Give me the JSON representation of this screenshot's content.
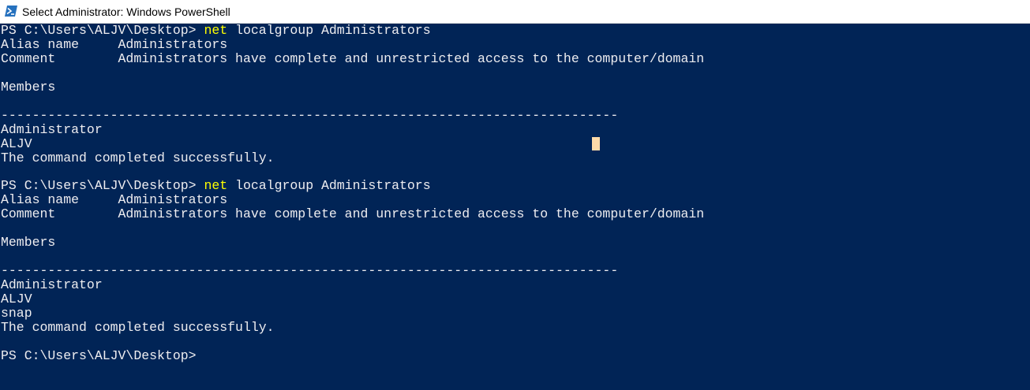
{
  "window": {
    "title": "Select Administrator: Windows PowerShell",
    "icon": "powershell-icon"
  },
  "colors": {
    "background": "#012456",
    "foreground": "#eeedf0",
    "command": "#ffff00",
    "cursor": "#fedba9"
  },
  "console": {
    "blocks": [
      {
        "prompt": "PS C:\\Users\\ALJV\\Desktop> ",
        "command": "net",
        "args": " localgroup Administrators",
        "alias_label": "Alias name     ",
        "alias_value": "Administrators",
        "comment_label": "Comment        ",
        "comment_value": "Administrators have complete and unrestricted access to the computer/domain",
        "members_header": "Members",
        "separator": "-------------------------------------------------------------------------------",
        "members": [
          "Administrator",
          "ALJV"
        ],
        "result": "The command completed successfully."
      },
      {
        "prompt": "PS C:\\Users\\ALJV\\Desktop> ",
        "command": "net",
        "args": " localgroup Administrators",
        "alias_label": "Alias name     ",
        "alias_value": "Administrators",
        "comment_label": "Comment        ",
        "comment_value": "Administrators have complete and unrestricted access to the computer/domain",
        "members_header": "Members",
        "separator": "-------------------------------------------------------------------------------",
        "members": [
          "Administrator",
          "ALJV",
          "snap"
        ],
        "result": "The command completed successfully."
      }
    ],
    "final_prompt": "PS C:\\Users\\ALJV\\Desktop>"
  }
}
